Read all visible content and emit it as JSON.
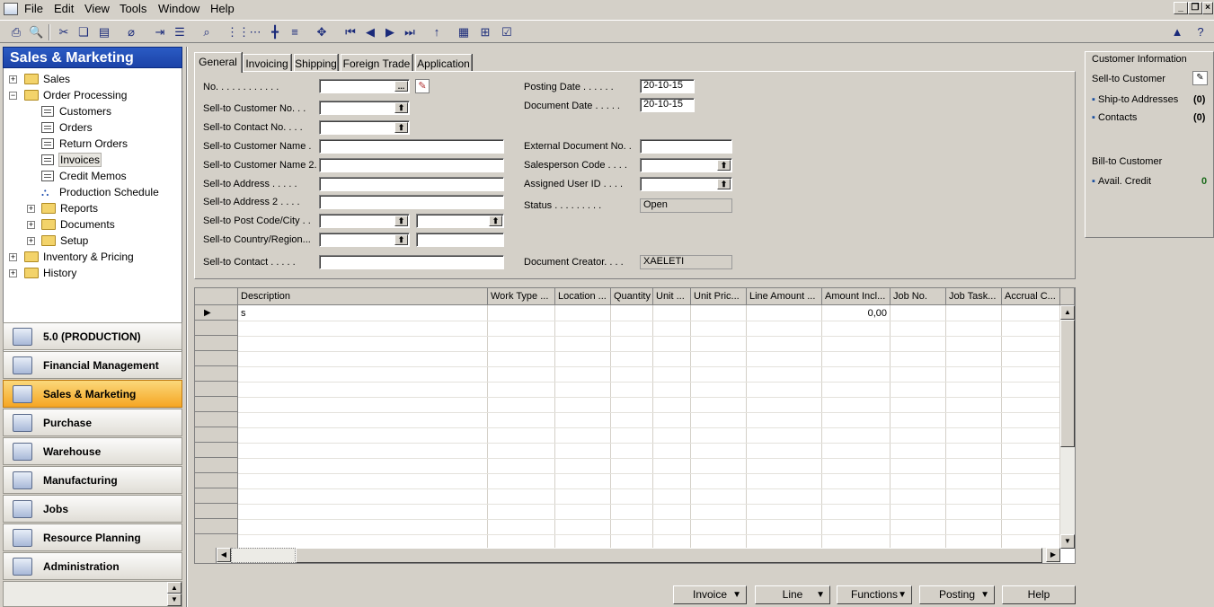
{
  "menubar": {
    "items": [
      {
        "label": "File"
      },
      {
        "label": "Edit"
      },
      {
        "label": "View"
      },
      {
        "label": "Tools"
      },
      {
        "label": "Window"
      },
      {
        "label": "Help"
      }
    ]
  },
  "toolbar": {
    "icons": [
      "print-icon",
      "print-preview-icon",
      "cut-icon",
      "copy-icon",
      "paste-icon",
      "attach-icon",
      "field-filter-icon",
      "find-icon",
      "list-icon",
      "table-icon",
      "flowfilter-icon",
      "lines-icon",
      "align-icon",
      "first-record-icon",
      "previous-record-icon",
      "next-record-icon",
      "last-record-icon",
      "up-icon",
      "word-icon",
      "excel-icon",
      "checklist-icon",
      "chart-icon",
      "help-icon"
    ]
  },
  "nav": {
    "title": "Sales & Marketing",
    "tree": [
      {
        "label": "Sales",
        "exp": "+",
        "type": "folder"
      },
      {
        "label": "Order Processing",
        "exp": "−",
        "type": "folder"
      },
      {
        "label": "Customers",
        "type": "doc"
      },
      {
        "label": "Orders",
        "type": "doc"
      },
      {
        "label": "Return Orders",
        "type": "doc"
      },
      {
        "label": "Invoices",
        "type": "doc",
        "selected": true
      },
      {
        "label": "Credit Memos",
        "type": "doc"
      },
      {
        "label": "Production Schedule",
        "type": "flow"
      },
      {
        "label": "Reports",
        "exp": "+",
        "type": "folder"
      },
      {
        "label": "Documents",
        "exp": "+",
        "type": "folder"
      },
      {
        "label": "Setup",
        "exp": "+",
        "type": "folder"
      },
      {
        "label": "Inventory & Pricing",
        "exp": "+",
        "type": "folder"
      },
      {
        "label": "History",
        "exp": "+",
        "type": "folder"
      }
    ],
    "buttons": [
      {
        "label": "5.0 (PRODUCTION)"
      },
      {
        "label": "Financial Management"
      },
      {
        "label": "Sales & Marketing",
        "active": true
      },
      {
        "label": "Purchase"
      },
      {
        "label": "Warehouse"
      },
      {
        "label": "Manufacturing"
      },
      {
        "label": "Jobs"
      },
      {
        "label": "Resource Planning"
      },
      {
        "label": "Administration"
      }
    ]
  },
  "tabs": [
    {
      "label": "General",
      "active": true
    },
    {
      "label": "Invoicing"
    },
    {
      "label": "Shipping"
    },
    {
      "label": "Foreign Trade"
    },
    {
      "label": "Application"
    }
  ],
  "form": {
    "left": [
      {
        "label": "No. . . . . . . . . . . .",
        "value": ""
      },
      {
        "label": "Sell-to Customer No. . .",
        "value": ""
      },
      {
        "label": "Sell-to Contact No. . . .",
        "value": ""
      },
      {
        "label": "Sell-to Customer Name  .",
        "value": ""
      },
      {
        "label": "Sell-to Customer Name 2.",
        "value": ""
      },
      {
        "label": "Sell-to Address  . . . . .",
        "value": ""
      },
      {
        "label": "Sell-to Address 2  . . . .",
        "value": ""
      },
      {
        "label": "Sell-to Post Code/City . .",
        "value": "",
        "value2": ""
      },
      {
        "label": "Sell-to Country/Region...",
        "value": "",
        "value2": ""
      },
      {
        "label": "Sell-to Contact  . . . . .",
        "value": ""
      }
    ],
    "right": [
      {
        "label": "Posting Date  . . . . . .",
        "value": "20-10-15"
      },
      {
        "label": "Document Date . . . . .",
        "value": "20-10-15"
      },
      {
        "label": "External Document No.  .",
        "value": ""
      },
      {
        "label": "Salesperson Code . . . .",
        "value": ""
      },
      {
        "label": "Assigned User ID  . . . .",
        "value": ""
      },
      {
        "label": "Status  . . . . . . . . .",
        "value": "Open"
      },
      {
        "label": "Document Creator. . . .",
        "value": "XAELETI"
      }
    ]
  },
  "grid": {
    "columns": [
      "Description",
      "Work Type ...",
      "Location ...",
      "Quantity",
      "Unit ...",
      "Unit Pric...",
      "Line Amount ...",
      "Amount Incl...",
      "Job No.",
      "Job Task...",
      "Accrual C..."
    ],
    "rows": [
      {
        "description": "s",
        "amount_incl": "0,00"
      }
    ]
  },
  "info": {
    "section1_title": "Customer Information",
    "sell_to_customer": "Sell-to Customer",
    "ship_to_addresses": "Ship-to Addresses",
    "ship_to_count": "(0)",
    "contacts": "Contacts",
    "contacts_count": "(0)",
    "section2_title": "Bill-to Customer",
    "avail_credit": "Avail. Credit",
    "avail_credit_value": "0"
  },
  "buttons": {
    "invoice": "Invoice",
    "line": "Line",
    "functions": "Functions",
    "posting": "Posting",
    "help": "Help"
  },
  "colors": {
    "nav_header": "#2a5bc4",
    "nav_active": "#f5a623",
    "face": "#d4d0c8"
  }
}
